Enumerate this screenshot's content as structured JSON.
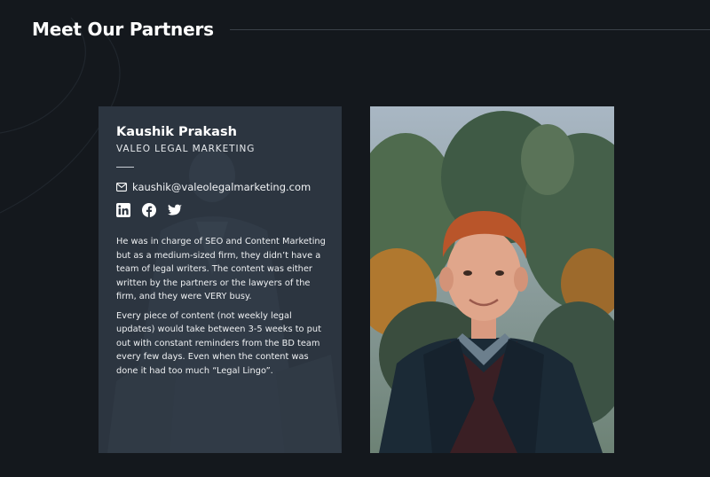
{
  "section": {
    "title": "Meet Our Partners"
  },
  "partner": {
    "name": "Kaushik Prakash",
    "company": "VALEO LEGAL MARKETING",
    "email": "kaushik@valeolegalmarketing.com",
    "social": [
      {
        "network": "linkedin",
        "icon": "linkedin-icon"
      },
      {
        "network": "facebook",
        "icon": "facebook-icon"
      },
      {
        "network": "twitter",
        "icon": "twitter-icon"
      }
    ],
    "bio": [
      "He was in charge of SEO and Content Marketing but as a medium-sized firm, they didn’t have a team of legal writers. The content was either written by the partners or the lawyers of the firm, and they were VERY busy.",
      "Every piece of content (not weekly legal updates) would take between 3-5 weeks to put out with constant reminders from the BD team every few days. Even when the content was done it had too much “Legal Lingo”."
    ]
  },
  "colors": {
    "background": "#14181d",
    "card": "#2c3540",
    "text": "#ffffff"
  }
}
